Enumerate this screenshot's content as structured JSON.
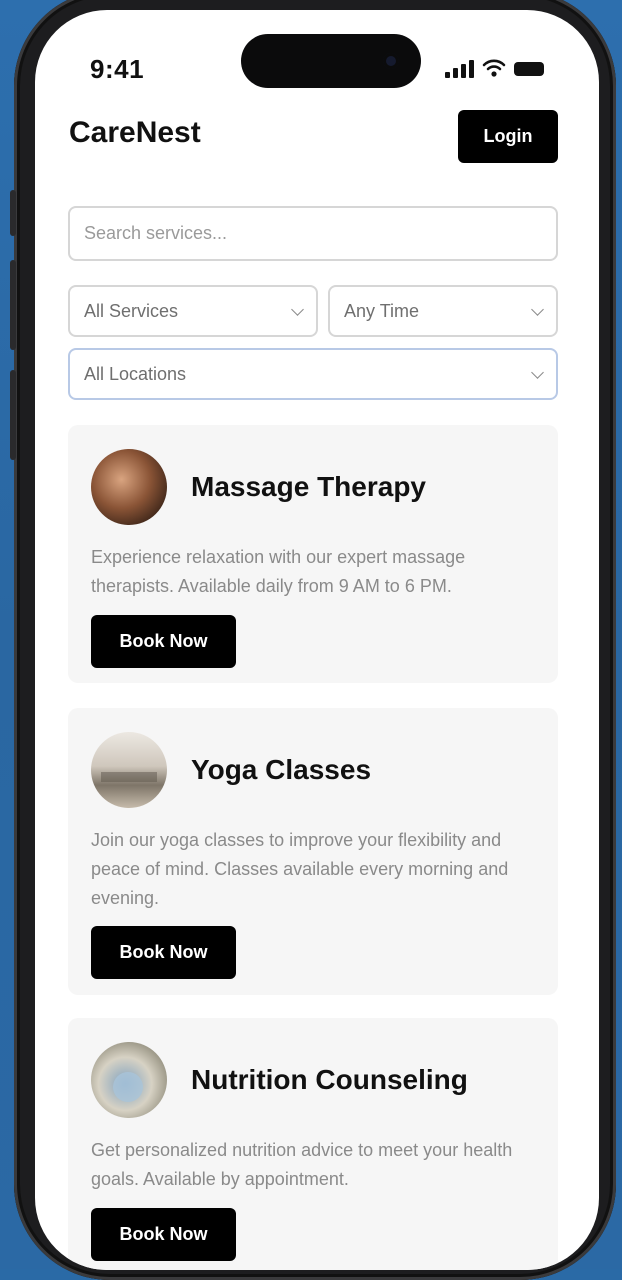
{
  "status_bar": {
    "time": "9:41"
  },
  "header": {
    "app_title": "CareNest",
    "login_label": "Login"
  },
  "search": {
    "placeholder": "Search services..."
  },
  "filters": {
    "services": "All Services",
    "time": "Any Time",
    "locations": "All Locations"
  },
  "services": [
    {
      "title": "Massage Therapy",
      "description": "Experience relaxation with our expert massage therapists. Available daily from 9 AM to 6 PM.",
      "button": "Book Now"
    },
    {
      "title": "Yoga Classes",
      "description": "Join our yoga classes to improve your flexibility and peace of mind. Classes available every morning and evening.",
      "button": "Book Now"
    },
    {
      "title": "Nutrition Counseling",
      "description": "Get personalized nutrition advice to meet your health goals. Available by appointment.",
      "button": "Book Now"
    }
  ]
}
